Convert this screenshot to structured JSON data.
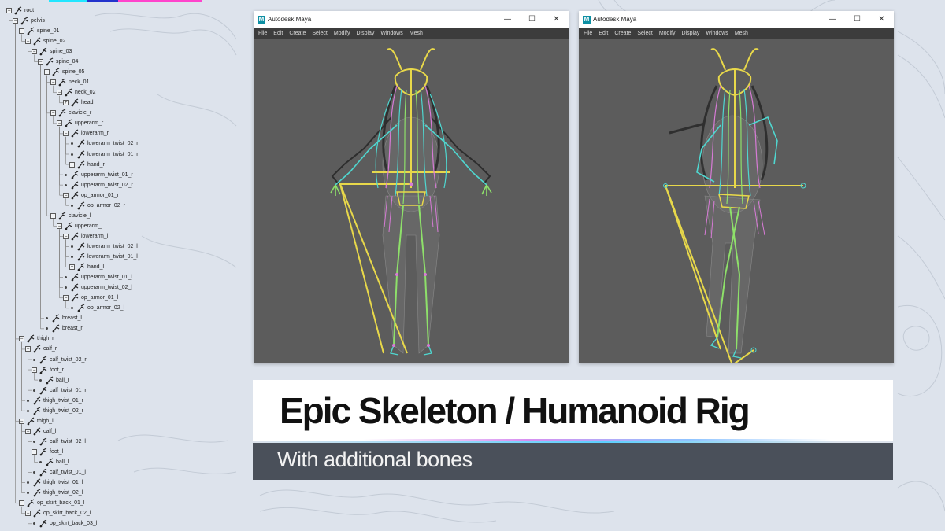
{
  "window": {
    "title": "Autodesk Maya",
    "menu": [
      "File",
      "Edit",
      "Create",
      "Select",
      "Modify",
      "Display",
      "Windows",
      "Mesh"
    ],
    "buttons": {
      "minimize": "—",
      "maximize": "☐",
      "close": "✕"
    }
  },
  "hierarchy": [
    {
      "label": "root",
      "depth": 0,
      "expanded": true
    },
    {
      "label": "pelvis",
      "depth": 1,
      "expanded": true
    },
    {
      "label": "spine_01",
      "depth": 2,
      "expanded": true
    },
    {
      "label": "spine_02",
      "depth": 3,
      "expanded": true
    },
    {
      "label": "spine_03",
      "depth": 4,
      "expanded": true
    },
    {
      "label": "spine_04",
      "depth": 5,
      "expanded": true
    },
    {
      "label": "spine_05",
      "depth": 6,
      "expanded": true
    },
    {
      "label": "neck_01",
      "depth": 7,
      "expanded": true
    },
    {
      "label": "neck_02",
      "depth": 8,
      "expanded": true
    },
    {
      "label": "head",
      "depth": 9,
      "expanded": false
    },
    {
      "label": "clavicle_r",
      "depth": 7,
      "expanded": true
    },
    {
      "label": "upperarm_r",
      "depth": 8,
      "expanded": true
    },
    {
      "label": "lowerarm_r",
      "depth": 9,
      "expanded": true
    },
    {
      "label": "lowerarm_twist_02_r",
      "depth": 10,
      "leaf": true
    },
    {
      "label": "lowerarm_twist_01_r",
      "depth": 10,
      "leaf": true
    },
    {
      "label": "hand_r",
      "depth": 10,
      "expanded": false
    },
    {
      "label": "upperarm_twist_01_r",
      "depth": 9,
      "leaf": true
    },
    {
      "label": "upperarm_twist_02_r",
      "depth": 9,
      "leaf": true
    },
    {
      "label": "op_armor_01_r",
      "depth": 9,
      "expanded": true
    },
    {
      "label": "op_armor_02_r",
      "depth": 10,
      "leaf": true
    },
    {
      "label": "clavicle_l",
      "depth": 7,
      "expanded": true
    },
    {
      "label": "upperarm_l",
      "depth": 8,
      "expanded": true
    },
    {
      "label": "lowerarm_l",
      "depth": 9,
      "expanded": true
    },
    {
      "label": "lowerarm_twist_02_l",
      "depth": 10,
      "leaf": true
    },
    {
      "label": "lowerarm_twist_01_l",
      "depth": 10,
      "leaf": true
    },
    {
      "label": "hand_l",
      "depth": 10,
      "expanded": false
    },
    {
      "label": "upperarm_twist_01_l",
      "depth": 9,
      "leaf": true
    },
    {
      "label": "upperarm_twist_02_l",
      "depth": 9,
      "leaf": true
    },
    {
      "label": "op_armor_01_l",
      "depth": 9,
      "expanded": true
    },
    {
      "label": "op_armor_02_l",
      "depth": 10,
      "leaf": true
    },
    {
      "label": "breast_l",
      "depth": 6,
      "leaf": true
    },
    {
      "label": "breast_r",
      "depth": 6,
      "leaf": true
    },
    {
      "label": "thigh_r",
      "depth": 2,
      "expanded": true
    },
    {
      "label": "calf_r",
      "depth": 3,
      "expanded": true
    },
    {
      "label": "calf_twist_02_r",
      "depth": 4,
      "leaf": true
    },
    {
      "label": "foot_r",
      "depth": 4,
      "expanded": true
    },
    {
      "label": "ball_r",
      "depth": 5,
      "leaf": true
    },
    {
      "label": "calf_twist_01_r",
      "depth": 4,
      "leaf": true
    },
    {
      "label": "thigh_twist_01_r",
      "depth": 3,
      "leaf": true
    },
    {
      "label": "thigh_twist_02_r",
      "depth": 3,
      "leaf": true
    },
    {
      "label": "thigh_l",
      "depth": 2,
      "expanded": true
    },
    {
      "label": "calf_l",
      "depth": 3,
      "expanded": true
    },
    {
      "label": "calf_twist_02_l",
      "depth": 4,
      "leaf": true
    },
    {
      "label": "foot_l",
      "depth": 4,
      "expanded": true
    },
    {
      "label": "ball_l",
      "depth": 5,
      "leaf": true
    },
    {
      "label": "calf_twist_01_l",
      "depth": 4,
      "leaf": true
    },
    {
      "label": "thigh_twist_01_l",
      "depth": 3,
      "leaf": true
    },
    {
      "label": "thigh_twist_02_l",
      "depth": 3,
      "leaf": true
    },
    {
      "label": "op_skirt_back_01_l",
      "depth": 2,
      "expanded": true
    },
    {
      "label": "op_skirt_back_02_l",
      "depth": 3,
      "expanded": true
    },
    {
      "label": "op_skirt_back_03_l",
      "depth": 4,
      "leaf": true
    }
  ],
  "banner": {
    "title": "Epic Skeleton / Humanoid Rig",
    "subtitle": "With additional bones"
  },
  "colors": {
    "accent_cyan": "#22e6ff",
    "accent_blue": "#2233cc",
    "accent_pink": "#ff44cc",
    "viewport_bg": "#5c5c5c",
    "joint_yellow": "#e8d84a",
    "joint_green": "#8ee06a",
    "joint_cyan": "#4fd7d0",
    "joint_pink": "#d77bd6",
    "subbar_bg": "#4a505a"
  }
}
